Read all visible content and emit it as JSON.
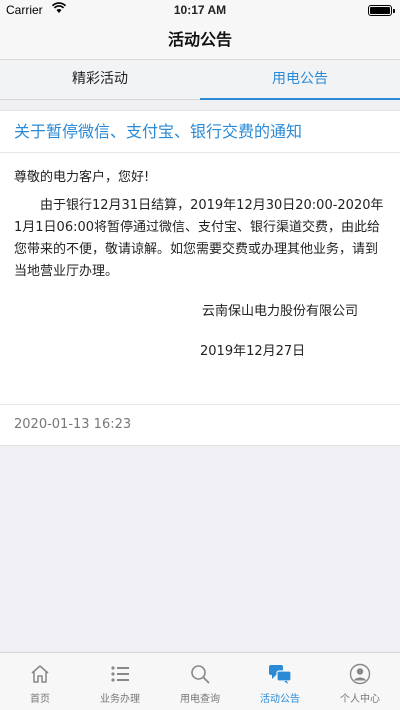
{
  "status_bar": {
    "carrier": "Carrier",
    "time": "10:17 AM"
  },
  "nav": {
    "title": "活动公告"
  },
  "tabs": [
    {
      "label": "精彩活动",
      "active": false
    },
    {
      "label": "用电公告",
      "active": true
    }
  ],
  "notice": {
    "title": "关于暂停微信、支付宝、银行交费的通知",
    "greeting": "尊敬的电力客户，您好!",
    "content": "由于银行12月31日结算，2019年12月30日20:00-2020年1月1日06:00将暂停通过微信、支付宝、银行渠道交费，由此给您带来的不便，敬请谅解。如您需要交费或办理其他业务，请到当地营业厅办理。",
    "signature": "云南保山电力股份有限公司",
    "sign_date": "2019年12月27日",
    "timestamp": "2020-01-13 16:23"
  },
  "tab_bar": [
    {
      "label": "首页",
      "icon": "home-icon"
    },
    {
      "label": "业务办理",
      "icon": "list-icon"
    },
    {
      "label": "用电查询",
      "icon": "search-icon"
    },
    {
      "label": "活动公告",
      "icon": "chat-icon",
      "active": true
    },
    {
      "label": "个人中心",
      "icon": "user-icon"
    }
  ],
  "colors": {
    "accent": "#2a8ad6",
    "inactive": "#777777"
  }
}
